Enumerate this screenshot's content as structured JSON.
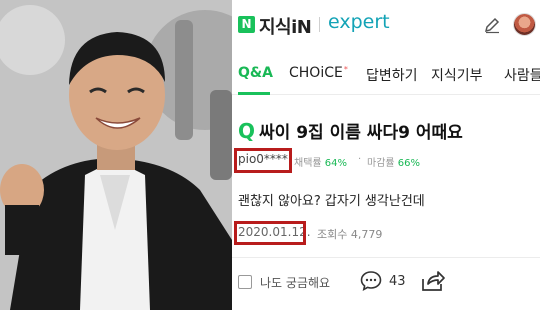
{
  "app": {
    "logo_badge": "N",
    "logo_text": "지식iN",
    "logo_expert": "expert",
    "accent": "#19c15b",
    "expert_color": "#13a3b6",
    "highlight_color": "#b81c1c"
  },
  "header_icons": [
    "pencil-icon",
    "profile-avatar"
  ],
  "tabs": [
    {
      "label": "Q&A",
      "active": true
    },
    {
      "label": "CHOiCE",
      "badge": "*",
      "active": false
    },
    {
      "label": "답변하기",
      "active": false
    },
    {
      "label": "지식기부",
      "active": false
    },
    {
      "label": "사람들",
      "active": false
    }
  ],
  "question": {
    "q_mark": "Q",
    "title": "싸이 9집 이름 싸다9 어때요",
    "user_id": "pio0****",
    "selection_rate_label": "채택률",
    "selection_rate": "64%",
    "deadline_rate_label": "마감률",
    "deadline_rate": "66%",
    "stat_separator": "·",
    "body": "괜찮지 않아요? 갑자기 생각난건데",
    "date": "2020.01.12.",
    "views_label": "조회수",
    "views": "4,779"
  },
  "actions": {
    "wonder_label": "나도 궁금해요",
    "comment_count": "43"
  }
}
